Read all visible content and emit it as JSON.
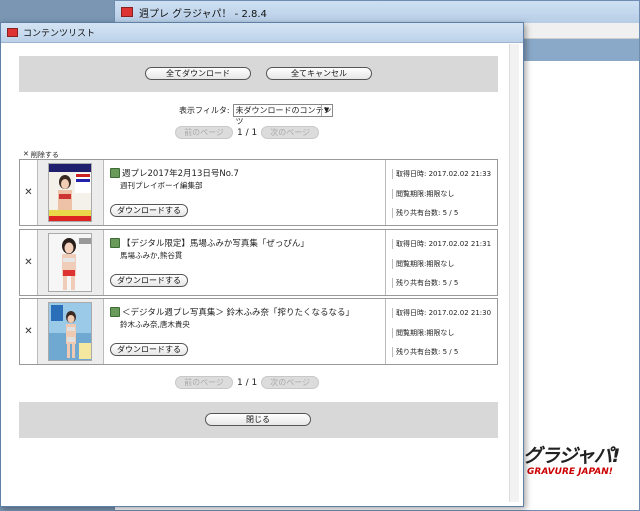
{
  "background_window": {
    "title": "週プレ グラジャパ！ - 2.8.4",
    "logo_main": "グラジャパ!",
    "logo_sub": "GRAVURE JAPAN!"
  },
  "dialog": {
    "title": "コンテンツリスト",
    "download_all": "全てダウンロード",
    "cancel_all": "全てキャンセル",
    "filter_label": "表示フィルタ:",
    "filter_value": "未ダウンロードのコンテンツ",
    "prev_page": "前のページ",
    "next_page": "次のページ",
    "page_info": "1 / 1",
    "delete_label": "削除する",
    "close": "閉じる",
    "meta_labels": {
      "acquired": "取得日時:",
      "period": "閲覧期限:",
      "devices": "残り共有台数:"
    },
    "download_label": "ダウンロードする",
    "items": [
      {
        "title": "週プレ2017年2月13日号No.7",
        "author": "週刊プレイボーイ編集部",
        "acquired": "2017.02.02 21:33",
        "period": "期限なし",
        "devices": "5 / 5"
      },
      {
        "title": "【デジタル限定】馬場ふみか写真集「ぜっぴん」",
        "author": "馬場ふみか,熊谷貫",
        "acquired": "2017.02.02 21:31",
        "period": "期限なし",
        "devices": "5 / 5"
      },
      {
        "title": "＜デジタル週プレ写真集＞ 鈴木ふみ奈「搾りたくなるなる」",
        "author": "鈴木ふみ奈,唐木貴央",
        "acquired": "2017.02.02 21:30",
        "period": "期限なし",
        "devices": "5 / 5"
      }
    ]
  }
}
